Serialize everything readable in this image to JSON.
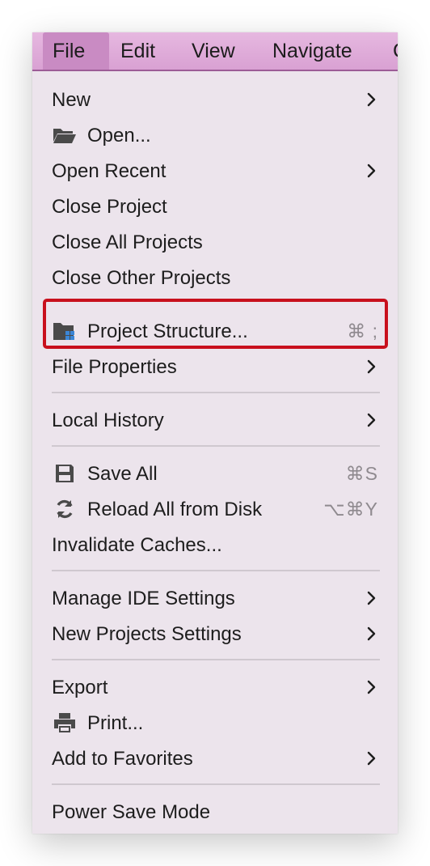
{
  "menubar": {
    "items": [
      {
        "label": "File"
      },
      {
        "label": "Edit"
      },
      {
        "label": "View"
      },
      {
        "label": "Navigate"
      },
      {
        "label": "C"
      }
    ]
  },
  "menu": {
    "items": [
      {
        "label": "New"
      },
      {
        "label": "Open..."
      },
      {
        "label": "Open Recent"
      },
      {
        "label": "Close Project"
      },
      {
        "label": "Close All Projects"
      },
      {
        "label": "Close Other Projects"
      },
      {
        "label": "Project Structure...",
        "shortcut": "⌘ ;"
      },
      {
        "label": "File Properties"
      },
      {
        "label": "Local History"
      },
      {
        "label": "Save All",
        "shortcut": "⌘S"
      },
      {
        "label": "Reload All from Disk",
        "shortcut": "⌥⌘Y"
      },
      {
        "label": "Invalidate Caches..."
      },
      {
        "label": "Manage IDE Settings"
      },
      {
        "label": "New Projects Settings"
      },
      {
        "label": "Export"
      },
      {
        "label": "Print..."
      },
      {
        "label": "Add to Favorites"
      },
      {
        "label": "Power Save Mode"
      }
    ]
  },
  "colors": {
    "menubar_bg": "#d9a1d3",
    "menu_bg": "#ece4ec",
    "highlight_border": "#c8101d",
    "shortcut_text": "#8f8a8f"
  }
}
